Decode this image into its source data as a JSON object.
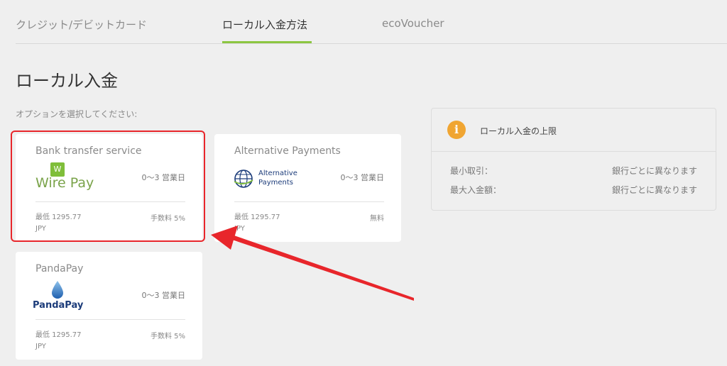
{
  "tabs": [
    {
      "label": "クレジット/デビットカード",
      "active": false
    },
    {
      "label": "ローカル入金方法",
      "active": true
    },
    {
      "label": "ecoVoucher",
      "active": false
    }
  ],
  "page_title": "ローカル入金",
  "prompt": "オプションを選択してください:",
  "options": [
    {
      "name": "Bank transfer service",
      "logo_text": "Wire Pay",
      "logo_badge": "W",
      "eta": "0～3 営業日",
      "minimum": "最低 1295.77 JPY",
      "fee": "手数料 5%",
      "highlighted": true
    },
    {
      "name": "Alternative Payments",
      "logo_text": "Alternative\nPayments",
      "eta": "0～3 営業日",
      "minimum": "最低 1295.77 JPY",
      "fee": "無料"
    },
    {
      "name": "PandaPay",
      "logo_text": "PandaPay",
      "eta": "0～3 営業日",
      "minimum": "最低 1295.77 JPY",
      "fee": "手数料 5%"
    }
  ],
  "limits": {
    "title": "ローカル入金の上限",
    "rows": [
      {
        "label": "最小取引：",
        "value": "銀行ごとに異なります"
      },
      {
        "label": "最大入金額：",
        "value": "銀行ごとに異なります"
      }
    ]
  },
  "colors": {
    "accent": "#8cc641",
    "highlight": "#e8262b",
    "info": "#f0a532"
  },
  "icons": [
    "info-icon",
    "globe-icon",
    "water-drop-icon",
    "wirepay-logo"
  ]
}
